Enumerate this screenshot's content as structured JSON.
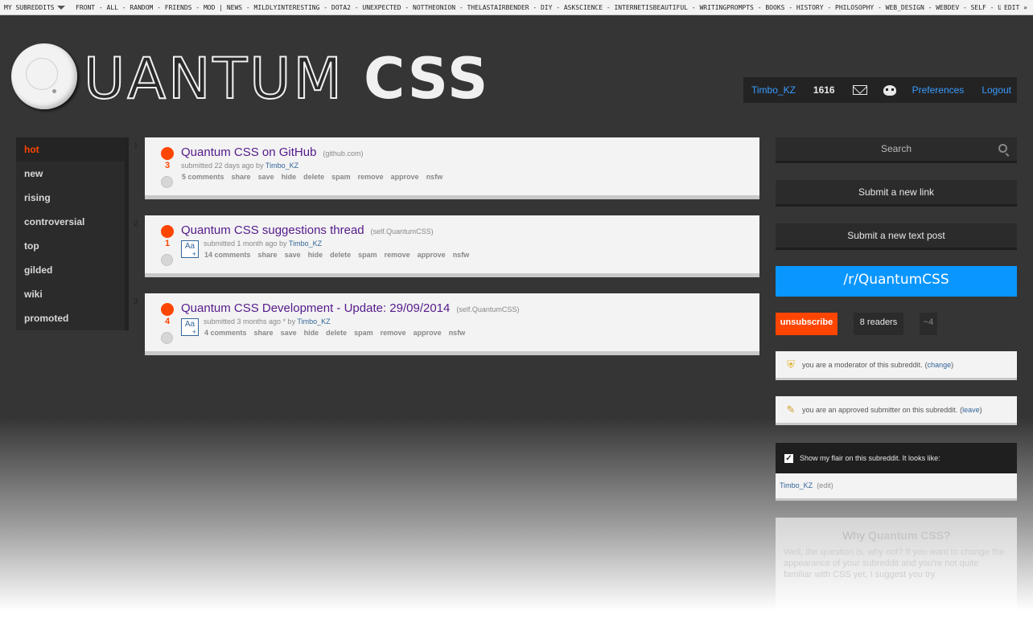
{
  "topbar": {
    "my_subreddits": "MY SUBREDDITS",
    "links": "FRONT - ALL - RANDOM - FRIENDS - MOD  |  NEWS - MILDLYINTERESTING - DOTA2 - UNEXPECTED - NOTTHEONION - THELASTAIRBENDER - DIY - ASKSCIENCE - INTERNETISBEAUTIFUL - WRITINGPROMPTS - BOOKS - HISTORY - PHILOSOPHY - WEB_DESIGN - WEBDEV - SELF - UNRESO",
    "edit": "EDIT »"
  },
  "header": {
    "logo_word1": "UANTUM",
    "logo_word2": "CSS",
    "username": "Timbo_KZ",
    "karma": "1616",
    "preferences": "Preferences",
    "logout": "Logout"
  },
  "leftnav": {
    "items": [
      {
        "label": "hot"
      },
      {
        "label": "new"
      },
      {
        "label": "rising"
      },
      {
        "label": "controversial"
      },
      {
        "label": "top"
      },
      {
        "label": "gilded"
      },
      {
        "label": "wiki"
      },
      {
        "label": "promoted"
      }
    ]
  },
  "posts": [
    {
      "rank": "1",
      "score": "3",
      "title": "Quantum CSS on GitHub",
      "domain": "(github.com)",
      "tagline_prefix": "submitted 22 days ago by",
      "author": "Timbo_KZ",
      "buttons": [
        "5 comments",
        "share",
        "save",
        "hide",
        "delete",
        "spam",
        "remove",
        "approve",
        "nsfw"
      ]
    },
    {
      "rank": "2",
      "score": "1",
      "title": "Quantum CSS suggestions thread",
      "domain": "(self.QuantumCSS)",
      "tagline_prefix": "submitted 1 month ago by",
      "author": "Timbo_KZ",
      "buttons": [
        "14 comments",
        "share",
        "save",
        "hide",
        "delete",
        "spam",
        "remove",
        "approve",
        "nsfw"
      ]
    },
    {
      "rank": "3",
      "score": "4",
      "title": "Quantum CSS Development - Update: 29/09/2014",
      "domain": "(self.QuantumCSS)",
      "tagline_prefix": "submitted 3 months ago * by",
      "author": "Timbo_KZ",
      "buttons": [
        "4 comments",
        "share",
        "save",
        "hide",
        "delete",
        "spam",
        "remove",
        "approve",
        "nsfw"
      ]
    }
  ],
  "thumb_label": "Aa",
  "sidebar": {
    "search_placeholder": "Search",
    "submit_link": "Submit a new link",
    "submit_text": "Submit a new text post",
    "subreddit_name": "/r/QuantumCSS",
    "unsubscribe": "unsubscribe",
    "readers": "8 readers",
    "online": "~4",
    "moderator_notice": "you are a moderator of this subreddit.",
    "moderator_link": "change",
    "approved_notice": "you are an approved submitter on this subreddit.",
    "approved_link": "leave",
    "flair_label": "Show my flair on this subreddit. It looks like:",
    "flair_user": "Timbo_KZ",
    "flair_edit": "(edit)",
    "why_prefix": "Why",
    "why_brand": "Quantum CSS",
    "why_suffix": "?",
    "why_text": "Well, the question is, why not? If you want to change the appearance of your subreddit and you're not quite familiar with CSS yet, I suggest you try"
  },
  "colors": {
    "accent": "#ff4500",
    "link": "#3a9cff",
    "subreddit_banner": "#0a96ff",
    "background": "#353535"
  }
}
